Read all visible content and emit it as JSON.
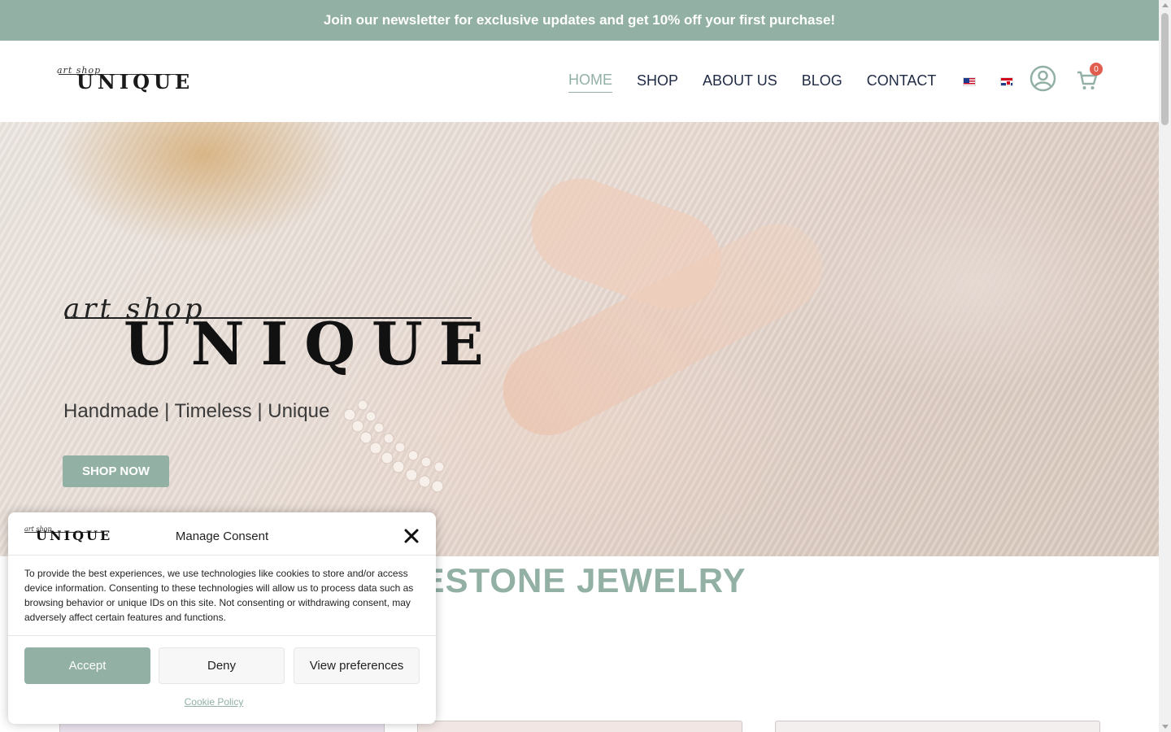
{
  "promo": {
    "text": "Join our newsletter for exclusive updates and get 10% off your first purchase!"
  },
  "header": {
    "logo": {
      "script": "art shop",
      "word": "UNIQUE"
    },
    "nav": [
      {
        "label": "HOME",
        "active": true
      },
      {
        "label": "SHOP",
        "active": false
      },
      {
        "label": "ABOUT US",
        "active": false
      },
      {
        "label": "BLOG",
        "active": false
      },
      {
        "label": "CONTACT",
        "active": false
      }
    ],
    "languages": [
      "en-us-flag-icon",
      "hr-flag-icon"
    ],
    "cart_count": "0"
  },
  "hero": {
    "logo": {
      "script": "art shop",
      "word": "UNIQUE"
    },
    "tagline": "Handmade | Timeless | Unique",
    "cta": "SHOP NOW"
  },
  "section": {
    "title": "MESTONE JEWELRY"
  },
  "consent": {
    "logo": {
      "script": "art shop",
      "word": "UNIQUE"
    },
    "title": "Manage Consent",
    "body": "To provide the best experiences, we use technologies like cookies to store and/or access device information. Consenting to these technologies will allow us to process data such as browsing behavior or unique IDs on this site. Not consenting or withdrawing consent, may adversely affect certain features and functions.",
    "accept": "Accept",
    "deny": "Deny",
    "preferences": "View preferences",
    "policy_link": "Cookie Policy"
  },
  "colors": {
    "accent": "#92b0a4",
    "text": "#1f2a44",
    "badge": "#e05d4f"
  }
}
